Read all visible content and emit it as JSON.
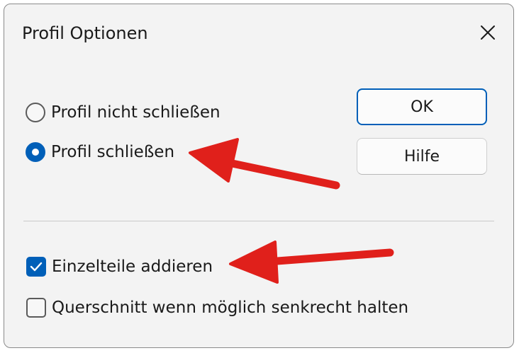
{
  "dialog": {
    "title": "Profil Optionen",
    "close_icon": "close-icon"
  },
  "radios": [
    {
      "label": "Profil nicht schließen",
      "checked": false
    },
    {
      "label": "Profil schließen",
      "checked": true
    }
  ],
  "buttons": {
    "ok_label": "OK",
    "help_label": "Hilfe"
  },
  "checkboxes": [
    {
      "label": "Einzelteile addieren",
      "checked": true
    },
    {
      "label": "Querschnitt wenn möglich senkrecht halten",
      "checked": false
    }
  ],
  "colors": {
    "accent": "#005fb8",
    "annotation_arrow": "#e0201b"
  }
}
